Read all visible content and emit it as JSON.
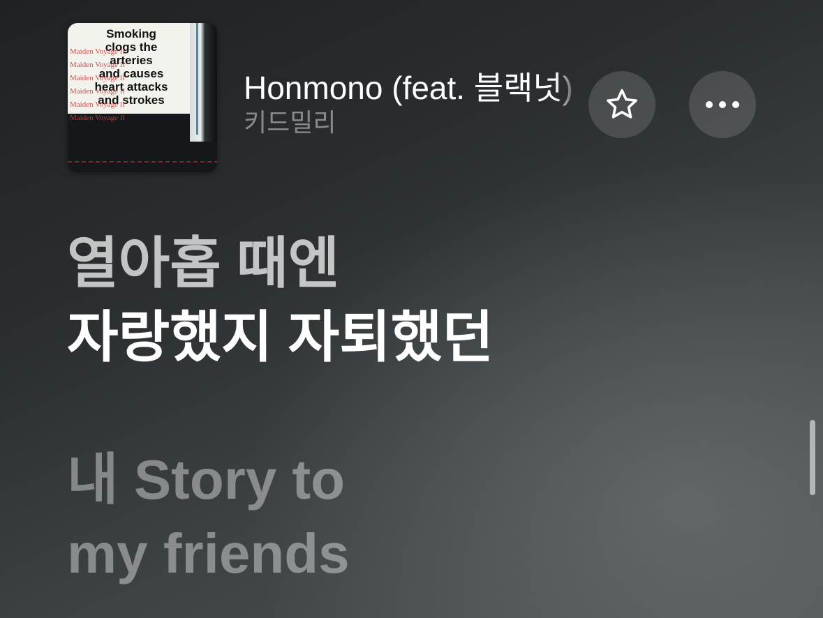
{
  "now_playing": {
    "title": "Honmono (feat. 블랙넛)",
    "artist": "키드밀리"
  },
  "artwork": {
    "warning_lines": [
      "Smoking",
      "clogs the",
      "arteries",
      "and causes",
      "heart attacks",
      "and strokes"
    ],
    "stamp_lines": [
      "Maiden Voyage II",
      "Maiden Voyage II",
      "Maiden Voyage II",
      "Maiden Voyage II",
      "Maiden Voyage II",
      "Maiden Voyage II"
    ]
  },
  "buttons": {
    "favorite_icon": "star-icon",
    "more_icon": "ellipsis-icon"
  },
  "lyrics": {
    "past": [
      "열아홉 때엔"
    ],
    "current": [
      "자랑했지 자퇴했던"
    ],
    "upcoming": [
      "내 Story to",
      "my friends"
    ]
  },
  "colors": {
    "current_lyric": "#ffffff",
    "dim_lyric": "rgba(255,255,255,0.40)",
    "artist_text": "rgba(255,255,255,0.45)",
    "button_bg": "rgba(255,255,255,0.14)"
  }
}
